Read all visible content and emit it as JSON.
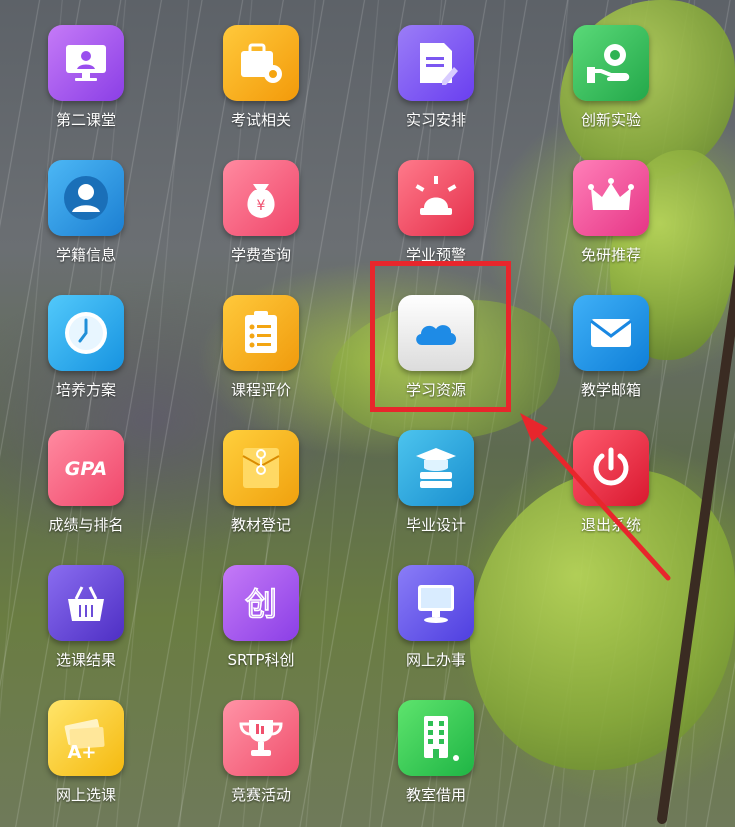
{
  "menu": {
    "items": [
      {
        "label": "第二课堂",
        "icon": "monitor-user-icon",
        "color": "#a55bf0"
      },
      {
        "label": "考试相关",
        "icon": "briefcase-gear-icon",
        "color": "#f7b21b"
      },
      {
        "label": "实习安排",
        "icon": "document-pen-icon",
        "color": "#7a5cf0"
      },
      {
        "label": "创新实验",
        "icon": "hand-gear-icon",
        "color": "#3bbf5b"
      },
      {
        "label": "学籍信息",
        "icon": "student-profile-icon",
        "color": "#2d9be0"
      },
      {
        "label": "学费查询",
        "icon": "money-bag-icon",
        "color": "#ff6b86"
      },
      {
        "label": "学业预警",
        "icon": "alarm-light-icon",
        "color": "#f04c62"
      },
      {
        "label": "免研推荐",
        "icon": "crown-icon",
        "color": "#f0549a"
      },
      {
        "label": "培养方案",
        "icon": "clock-icon",
        "color": "#27b2f0"
      },
      {
        "label": "课程评价",
        "icon": "checklist-icon",
        "color": "#f7b21b"
      },
      {
        "label": "学习资源",
        "icon": "cloud-icon",
        "color": "#f2f2f2"
      },
      {
        "label": "教学邮箱",
        "icon": "mail-icon",
        "color": "#1e95e6"
      },
      {
        "label": "成绩与排名",
        "icon": "gpa-icon",
        "color": "#ff5e7c"
      },
      {
        "label": "教材登记",
        "icon": "envelope-folder-icon",
        "color": "#f5b61e"
      },
      {
        "label": "毕业设计",
        "icon": "graduation-server-icon",
        "color": "#2aaee0"
      },
      {
        "label": "退出系统",
        "icon": "power-icon",
        "color": "#ef2d47"
      },
      {
        "label": "选课结果",
        "icon": "basket-icon",
        "color": "#6b4cd8"
      },
      {
        "label": "SRTP科创",
        "icon": "chuang-character-icon",
        "color": "#a55bf0"
      },
      {
        "label": "网上办事",
        "icon": "computer-icon",
        "color": "#6a5cf0"
      },
      {
        "label": "网上选课",
        "icon": "a-plus-money-icon",
        "color": "#ffd52a"
      },
      {
        "label": "竞赛活动",
        "icon": "trophy-icon",
        "color": "#ff6f8a"
      },
      {
        "label": "教室借用",
        "icon": "building-icon",
        "color": "#3bd35a"
      }
    ]
  },
  "annotation": {
    "highlight_color": "#e8262c",
    "target": "学习资源"
  }
}
